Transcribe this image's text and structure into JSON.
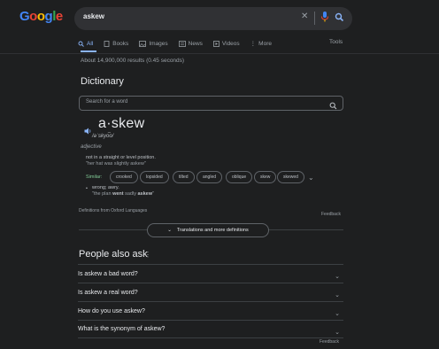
{
  "logo": {
    "text": "Google",
    "letters": [
      "G",
      "o",
      "o",
      "g",
      "l",
      "e"
    ],
    "colors": [
      "#4285f4",
      "#ea4335",
      "#fbbc05",
      "#4285f4",
      "#34a853",
      "#ea4335"
    ]
  },
  "search": {
    "query": "askew",
    "clear_icon": "close-icon",
    "mic_icon": "mic-icon",
    "search_icon": "search-icon"
  },
  "tabs": [
    {
      "label": "All",
      "icon": "search-icon",
      "active": true
    },
    {
      "label": "Books",
      "icon": "book-icon"
    },
    {
      "label": "Images",
      "icon": "image-icon"
    },
    {
      "label": "News",
      "icon": "news-icon"
    },
    {
      "label": "Videos",
      "icon": "video-icon"
    },
    {
      "label": "More",
      "icon": "more-icon"
    }
  ],
  "tools_label": "Tools",
  "results_count": "About 14,900,000 results (0.45 seconds)",
  "dictionary": {
    "title": "Dictionary",
    "search_placeholder": "Search for a word",
    "word": "a·skew",
    "phonetic": "/əˈskyo͞o/",
    "part_of_speech": "adjective",
    "def1": "not in a straight or level position.",
    "def1_example": "\"her hat was slightly askew\"",
    "similar_label": "Similar:",
    "similar": [
      "crooked",
      "lopsided",
      "tilted",
      "angled",
      "oblique",
      "skew",
      "skewed"
    ],
    "def2": "wrong; awry.",
    "def2_example_pre": "\"the plan ",
    "def2_example_bold1": "went",
    "def2_example_mid": " sadly ",
    "def2_example_bold2": "askew",
    "def2_example_post": "\"",
    "definitions_from": "Definitions from Oxford Languages",
    "feedback": "Feedback",
    "translations_button": "Translations and more definitions"
  },
  "people_also_ask": {
    "title": "People also ask",
    "questions": [
      "Is askew a bad word?",
      "Is askew a real word?",
      "How do you use askew?",
      "What is the synonym of askew?"
    ],
    "feedback": "Feedback"
  },
  "colors": {
    "background": "#1e1f20",
    "accent": "#8ab4f8",
    "similar_green": "#81c995"
  }
}
